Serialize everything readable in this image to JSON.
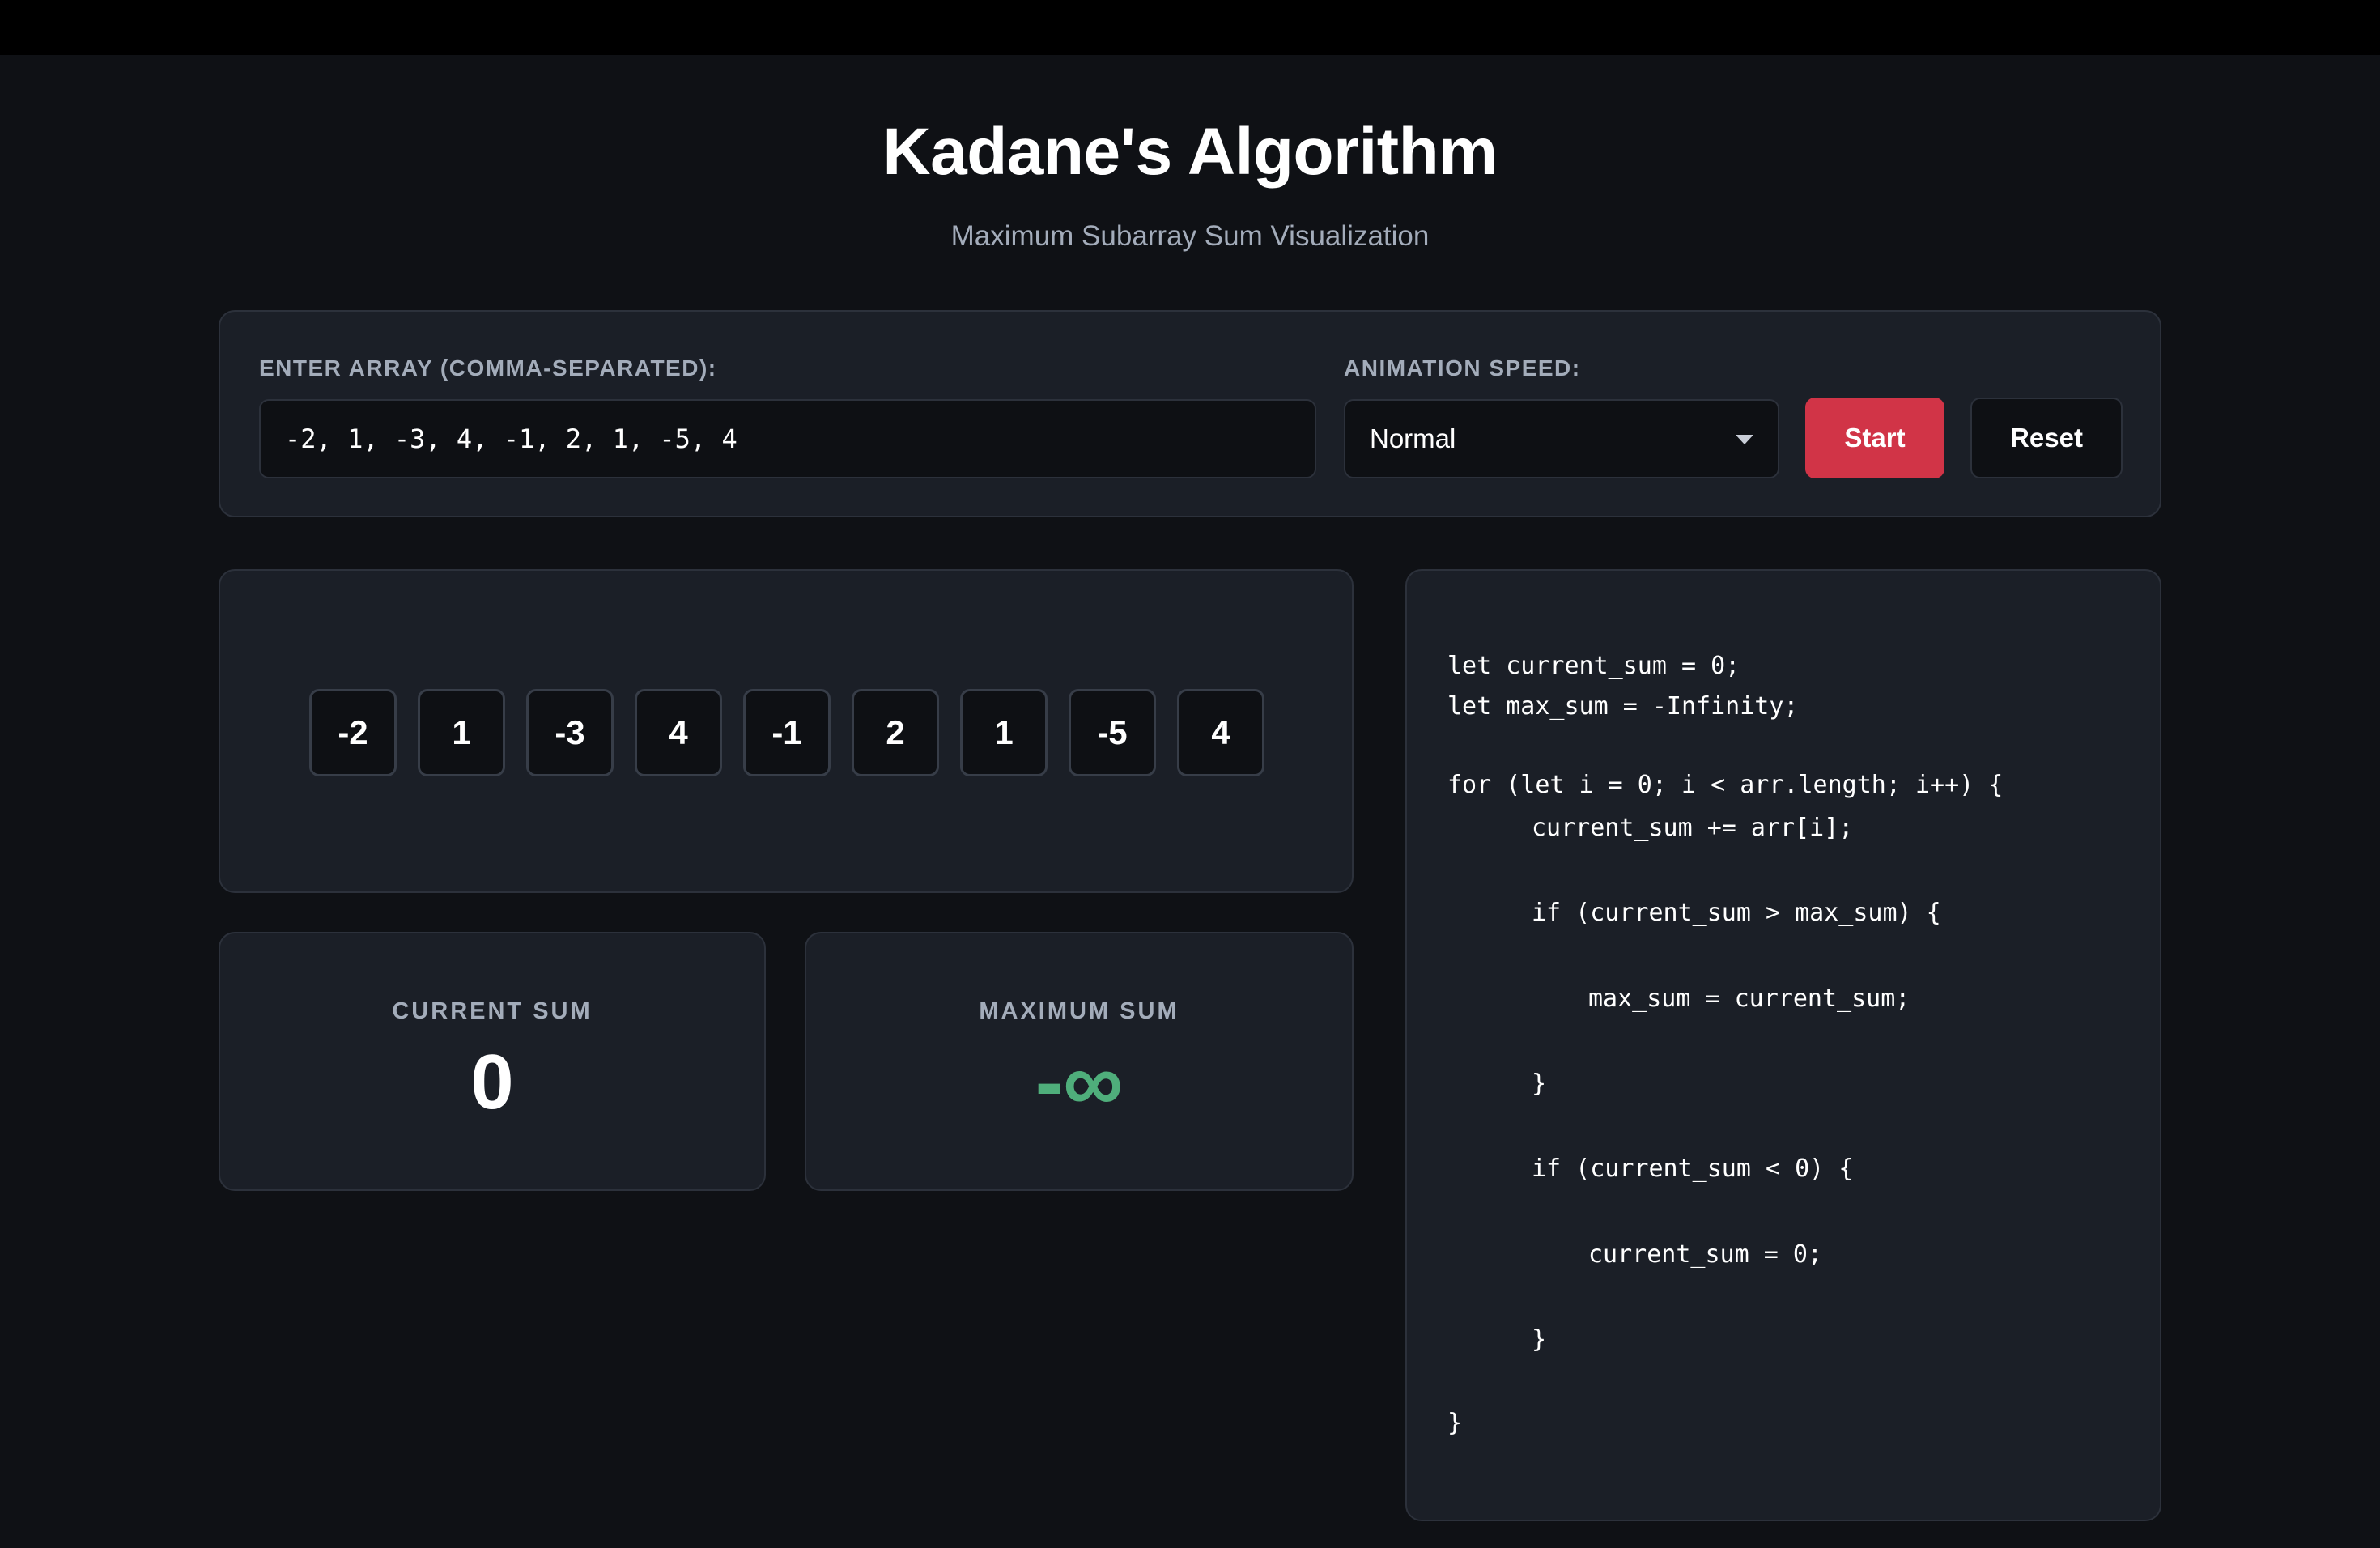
{
  "header": {
    "title": "Kadane's Algorithm",
    "subtitle": "Maximum Subarray Sum Visualization"
  },
  "controls": {
    "array_label": "ENTER ARRAY (COMMA-SEPARATED):",
    "array_value": "-2, 1, -3, 4, -1, 2, 1, -5, 4",
    "speed_label": "ANIMATION SPEED:",
    "speed_selected": "Normal",
    "start_label": "Start",
    "reset_label": "Reset"
  },
  "array": {
    "values": [
      "-2",
      "1",
      "-3",
      "4",
      "-1",
      "2",
      "1",
      "-5",
      "4"
    ]
  },
  "stats": {
    "current_label": "CURRENT SUM",
    "current_value": "0",
    "max_label": "MAXIMUM SUM",
    "max_value": "-∞"
  },
  "code": {
    "lines": [
      "let current_sum = 0;",
      "let max_sum = -Infinity;",
      "for (let i = 0; i < arr.length; i++) {",
      "current_sum += arr[i];",
      "if (current_sum > max_sum) {",
      "max_sum = current_sum;",
      "}",
      "if (current_sum < 0) {",
      "current_sum = 0;",
      "}",
      "}"
    ]
  },
  "colors": {
    "accent": "#d13447",
    "positive": "#4fae7b",
    "background": "#0f1115",
    "panel": "#1b1f27"
  }
}
